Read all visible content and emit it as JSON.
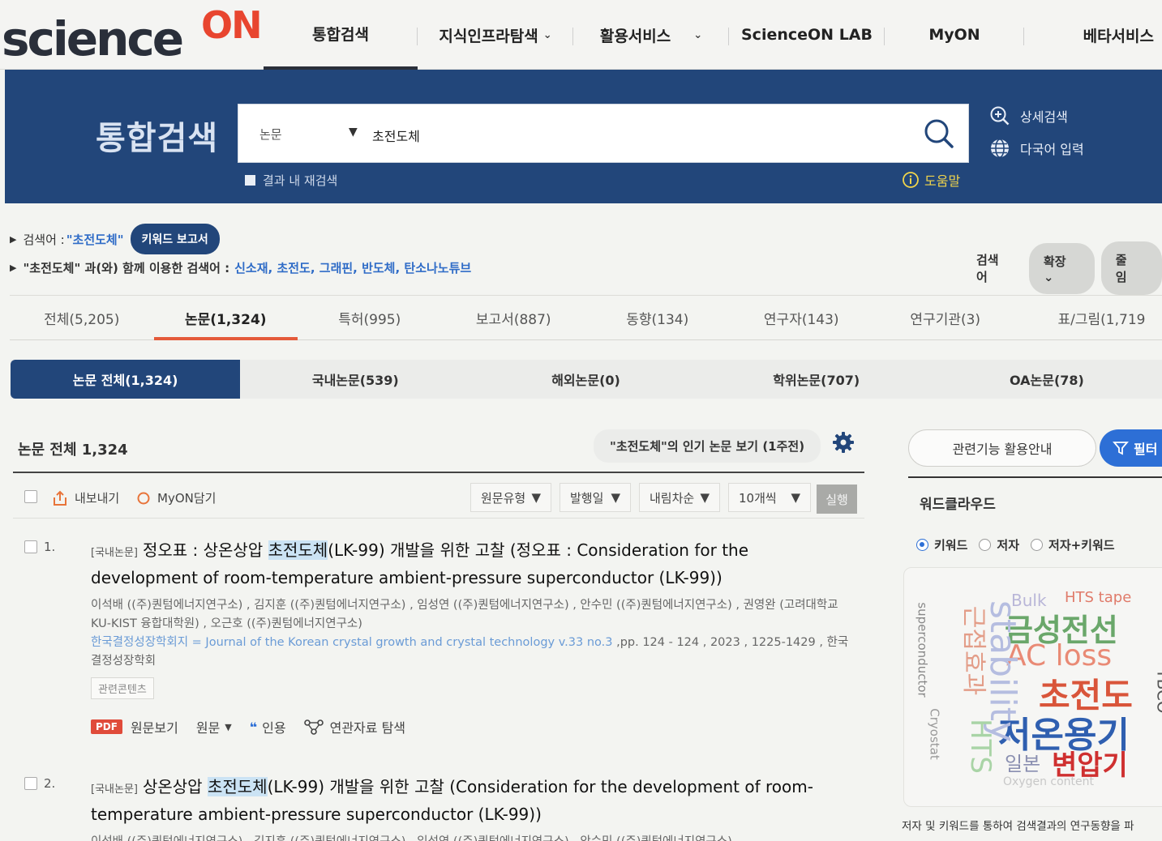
{
  "brand": {
    "logo_science": "science",
    "logo_on": "ON"
  },
  "nav": {
    "items": [
      {
        "label": "통합검색",
        "chevron": false
      },
      {
        "label": "지식인프라탐색",
        "chevron": true
      },
      {
        "label": "활용서비스",
        "chevron": true
      },
      {
        "label": "ScienceON LAB",
        "chevron": false
      },
      {
        "label": "MyON",
        "chevron": false
      },
      {
        "label": "베타서비스",
        "chevron": false
      }
    ]
  },
  "search": {
    "title": "통합검색",
    "category": "논문",
    "query": "초전도체",
    "in_result_label": "결과 내 재검색",
    "advanced_label": "상세검색",
    "multilang_label": "다국어 입력",
    "help_label": "도움말"
  },
  "keyword": {
    "search_term_prefix": "검색어 :",
    "search_term": "\"초전도체\"",
    "report_button": "키워드 보고서",
    "related_prefix": "\"초전도체\" 과(와) 함께 이용한 검색어 :",
    "related_terms": "신소재, 초전도, 그래핀, 반도체, 탄소나노튜브",
    "right_controls": {
      "search_word": "검색어",
      "expand": "확장",
      "reduce": "줄임"
    }
  },
  "tabs": [
    {
      "label": "전체(5,205)"
    },
    {
      "label": "논문(1,324)",
      "active": true
    },
    {
      "label": "특허(995)"
    },
    {
      "label": "보고서(887)"
    },
    {
      "label": "동향(134)"
    },
    {
      "label": "연구자(143)"
    },
    {
      "label": "연구기관(3)"
    },
    {
      "label": "표/그림(1,719"
    }
  ],
  "subtabs": [
    {
      "label": "논문 전체(1,324)",
      "active": true
    },
    {
      "label": "국내논문(539)"
    },
    {
      "label": "해외논문(0)"
    },
    {
      "label": "학위논문(707)"
    },
    {
      "label": "OA논문(78)"
    }
  ],
  "results_header": {
    "count_label": "논문 전체 1,324",
    "popular_label": "\"초전도체\"의 인기 논문 보기 (1주전)"
  },
  "toolbar": {
    "export": "내보내기",
    "myon": "MyON담기",
    "dropdowns": [
      "원문유형",
      "발행일",
      "내림차순",
      "10개씩"
    ],
    "run": "실행"
  },
  "results": [
    {
      "num": "1.",
      "tag": "[국내논문]",
      "title_pre": "정오표 : 상온상압 ",
      "title_hl": "초전도체",
      "title_post": "(LK-99) 개발을 위한 고찰 (정오표 : Consideration for the development of room-temperature ambient-pressure superconductor (LK-99))",
      "authors": "이석배 ((주)퀀텀에너지연구소) , 김지훈 ((주)퀀텀에너지연구소) , 임성연 ((주)퀀텀에너지연구소) , 안수민 ((주)퀀텀에너지연구소) , 권영완 (고려대학교 KU-KIST 융합대학원) , 오근호 ((주)퀀텀에너지연구소)",
      "journal": "한국결정성장학회지 = Journal of the Korean crystal growth and crystal technology v.33 no.3",
      "pub": " ,pp. 124 - 124 , 2023 , 1225-1429 , 한국결정성장학회",
      "related": "관련콘텐츠",
      "actions": {
        "pdf": "PDF",
        "view": "원문보기",
        "original": "원문",
        "cite": "인용",
        "explore": "연관자료 탐색"
      }
    },
    {
      "num": "2.",
      "tag": "[국내논문]",
      "title_pre": "상온상압 ",
      "title_hl": "초전도체",
      "title_post": "(LK-99) 개발을 위한 고찰 (Consideration for the development of room-temperature ambient-pressure superconductor (LK-99))",
      "authors": "이석배 ((주)퀀텀에너지연구소) , 김지훈 ((주)퀀텀에너지연구소) , 임성연 ((주)퀀텀에너지연구소) , 안수민 ((주)퀀텀에너지연구소)"
    }
  ],
  "sidebar": {
    "guide_button": "관련기능 활용안내",
    "filter_button": "필터",
    "wordcloud_title": "워드클라우드",
    "radios": [
      {
        "label": "키워드",
        "checked": true
      },
      {
        "label": "저자",
        "checked": false
      },
      {
        "label": "저자+키워드",
        "checked": false
      }
    ],
    "wordcloud_words": [
      "Bulk",
      "HTS tape",
      "금성전선",
      "AC loss",
      "초전도",
      "저온용기",
      "일본",
      "변압기",
      "superconductor",
      "Cryostat",
      "stability",
      "HTS",
      "근접효과",
      "YBCO",
      "Oxygen content"
    ],
    "note": "저자 및 키워드를 통하여 검색결과의 연구동향을 파"
  },
  "colors": {
    "primary": "#22467a",
    "accent": "#e8452f",
    "link": "#2f6cc7",
    "filter": "#2d6fd6"
  }
}
